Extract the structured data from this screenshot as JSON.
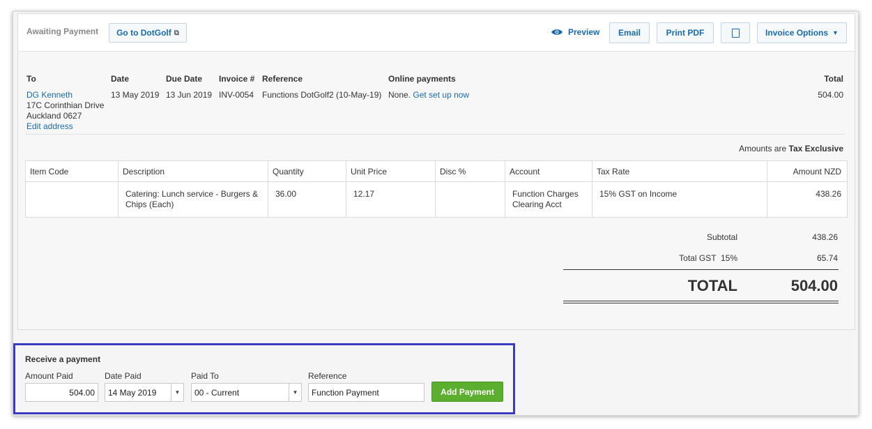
{
  "header": {
    "status": "Awaiting Payment",
    "goto_label": "Go to DotGolf",
    "preview_label": "Preview",
    "email_label": "Email",
    "print_pdf_label": "Print PDF",
    "invoice_options_label": "Invoice Options"
  },
  "invoice": {
    "headers": {
      "to": "To",
      "date": "Date",
      "due_date": "Due Date",
      "invoice_no": "Invoice #",
      "reference": "Reference",
      "online_payments": "Online payments",
      "total": "Total"
    },
    "to_name": "DG Kenneth",
    "address_line1": "17C Corinthian Drive",
    "address_line2": "Auckland 0627",
    "edit_address": "Edit address",
    "date": "13 May 2019",
    "due_date": "13 Jun 2019",
    "invoice_no": "INV-0054",
    "reference": "Functions DotGolf2 (10-May-19)",
    "online_payments_none": "None.",
    "online_payments_link": "Get set up now",
    "total": "504.00"
  },
  "amounts_note": {
    "prefix": "Amounts are",
    "mode": "Tax Exclusive"
  },
  "line_items": {
    "columns": [
      "Item Code",
      "Description",
      "Quantity",
      "Unit Price",
      "Disc %",
      "Account",
      "Tax Rate",
      "Amount NZD"
    ],
    "rows": [
      {
        "item_code": "",
        "description": "Catering: Lunch service - Burgers & Chips (Each)",
        "quantity": "36.00",
        "unit_price": "12.17",
        "disc": "",
        "account": "Function Charges Clearing Acct",
        "tax_rate": "15% GST on Income",
        "amount": "438.26"
      }
    ]
  },
  "totals": {
    "subtotal_label": "Subtotal",
    "subtotal": "438.26",
    "gst_label": "Total GST  15%",
    "gst": "65.74",
    "total_label": "TOTAL",
    "total": "504.00"
  },
  "payment": {
    "title": "Receive a payment",
    "amount_label": "Amount Paid",
    "amount_value": "504.00",
    "date_label": "Date Paid",
    "date_value": "14 May 2019",
    "paid_to_label": "Paid To",
    "paid_to_value": "00 - Current",
    "reference_label": "Reference",
    "reference_value": "Function Payment",
    "add_button": "Add Payment"
  },
  "colors": {
    "link": "#1a6aa8",
    "add_button": "#5cae2e",
    "highlight_border": "#3b3bbf"
  }
}
